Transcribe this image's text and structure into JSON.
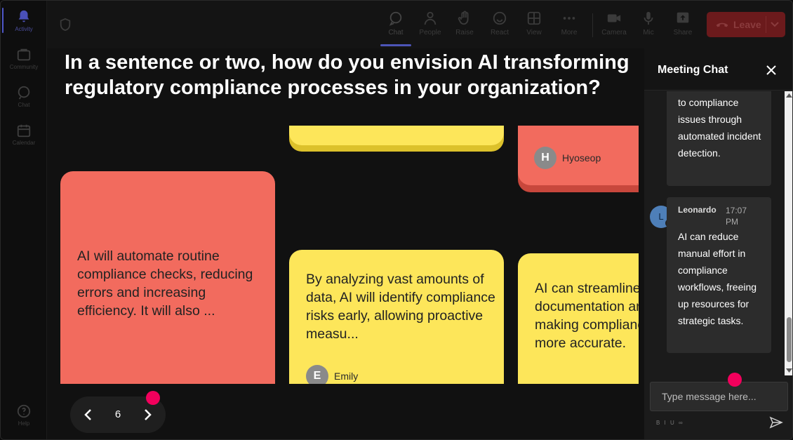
{
  "rail": {
    "items": [
      {
        "label": "Activity",
        "icon": "bell-icon"
      },
      {
        "label": "Community",
        "icon": "community-icon"
      },
      {
        "label": "Chat",
        "icon": "chat-bubble-icon"
      },
      {
        "label": "Calendar",
        "icon": "calendar-icon"
      },
      {
        "label": "Help",
        "icon": "help-icon"
      }
    ]
  },
  "toolbar": {
    "chat": "Chat",
    "people": "People",
    "raise": "Raise",
    "react": "React",
    "view": "View",
    "more": "More",
    "camera": "Camera",
    "mic": "Mic",
    "share": "Share",
    "leave": "Leave"
  },
  "question": "In a sentence or two, how do you envision AI transforming regulatory compliance processes in your organization?",
  "cards": [
    {
      "text": "",
      "author": ""
    },
    {
      "text": "",
      "author": "Hyoseop",
      "initial": "H"
    },
    {
      "text": "AI will automate routine compliance checks, reducing errors and increasing efficiency. It will also ...",
      "author": ""
    },
    {
      "text": "By analyzing vast amounts of data, AI will identify compliance risks early, allowing proactive measu...",
      "author": "Emily",
      "initial": "E"
    },
    {
      "text": "AI can streamline documentation and reporting, making compliance audits more accurate.",
      "author": ""
    }
  ],
  "pager": {
    "page": "6"
  },
  "chat": {
    "title": "Meeting Chat",
    "messages": [
      {
        "author": "",
        "time": "",
        "text": "to compliance issues through automated incident detection."
      },
      {
        "author": "Leonardo",
        "initial": "L",
        "time": "17:07 PM",
        "text": "AI can reduce manual effort in compliance workflows, freeing up resources for strategic tasks."
      }
    ],
    "input_placeholder": "Type message here...",
    "format_hint": "B I U ∞"
  },
  "colors": {
    "card_red": "#f26b5e",
    "card_yellow": "#fde65a",
    "leave": "#c4262b",
    "accent": "#4e57c8",
    "marker": "#f2005c"
  }
}
